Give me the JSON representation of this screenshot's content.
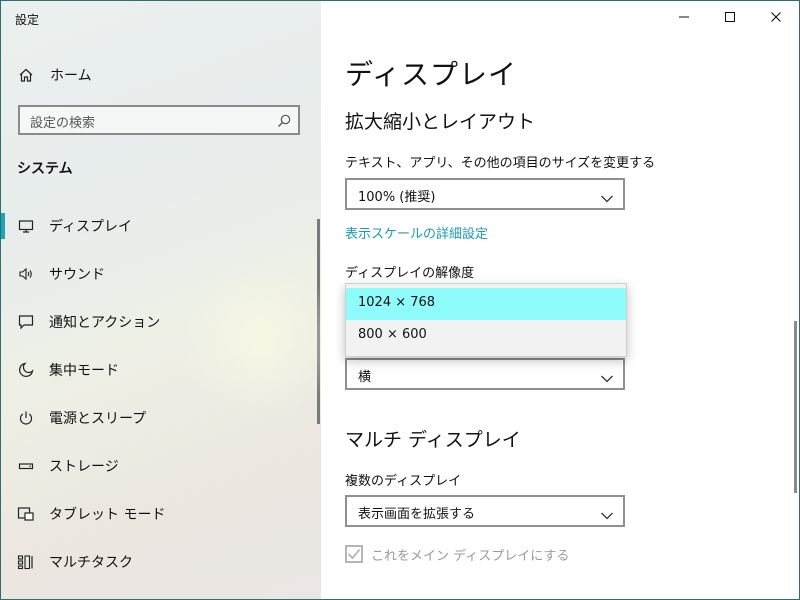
{
  "window": {
    "title": "設定"
  },
  "sidebar": {
    "home_label": "ホーム",
    "search_placeholder": "設定の検索",
    "section_title": "システム",
    "items": [
      {
        "label": "ディスプレイ",
        "icon": "monitor-icon",
        "active": true
      },
      {
        "label": "サウンド",
        "icon": "speaker-icon"
      },
      {
        "label": "通知とアクション",
        "icon": "message-icon"
      },
      {
        "label": "集中モード",
        "icon": "moon-icon"
      },
      {
        "label": "電源とスリープ",
        "icon": "power-icon"
      },
      {
        "label": "ストレージ",
        "icon": "storage-icon"
      },
      {
        "label": "タブレット モード",
        "icon": "tablet-icon"
      },
      {
        "label": "マルチタスク",
        "icon": "multitask-icon"
      }
    ]
  },
  "content": {
    "title": "ディスプレイ",
    "scale_section": "拡大縮小とレイアウト",
    "text_size_label": "テキスト、アプリ、その他の項目のサイズを変更する",
    "text_size_value": "100% (推奨)",
    "advanced_scale_link": "表示スケールの詳細設定",
    "resolution_label": "ディスプレイの解像度",
    "resolution_options": [
      "1024 × 768",
      "800 × 600"
    ],
    "resolution_selected_index": 0,
    "orientation_value": "横",
    "multi_section": "マルチ ディスプレイ",
    "multi_label": "複数のディスプレイ",
    "multi_value": "表示画面を拡張する",
    "main_display_checkbox": {
      "label": "これをメイン ディスプレイにする",
      "checked": true,
      "disabled": true
    }
  },
  "colors": {
    "accent": "#1aa6b7",
    "link": "#1b9bb0",
    "highlight": "#8dfcfb"
  }
}
